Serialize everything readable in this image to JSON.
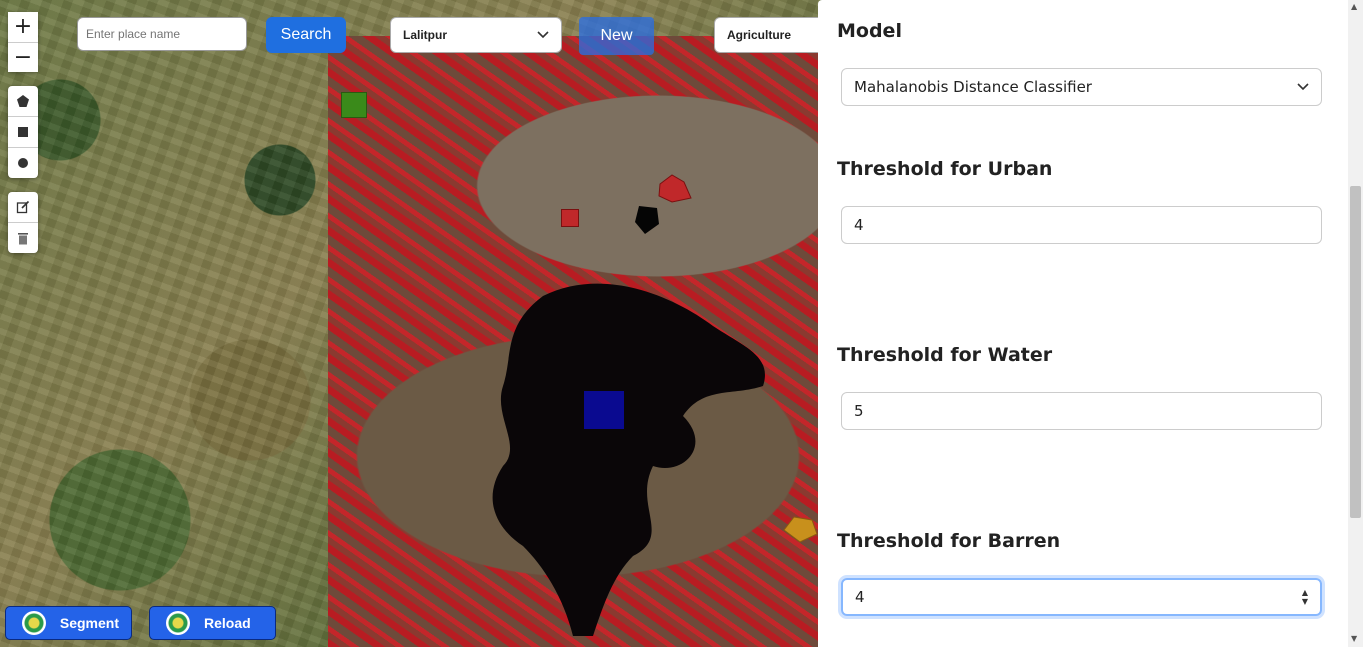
{
  "map": {
    "zoom_in": "+",
    "zoom_out": "−",
    "draw_tools": [
      "polygon-icon",
      "rectangle-icon",
      "circle-icon"
    ],
    "edit_tools": [
      "edit-icon",
      "trash-icon"
    ]
  },
  "toolbar": {
    "place_placeholder": "Enter place name",
    "search_label": "Search",
    "district_select": "Lalitpur",
    "new_label": "New",
    "class_select": "Agriculture"
  },
  "actions": {
    "segment_label": "Segment",
    "reload_label": "Reload"
  },
  "panel": {
    "model_heading": "Model",
    "model_value": "Mahalanobis Distance Classifier",
    "urban_heading": "Threshold for Urban",
    "urban_value": "4",
    "water_heading": "Threshold for Water",
    "water_value": "5",
    "barren_heading": "Threshold for Barren",
    "barren_value": "4"
  },
  "colors": {
    "accent": "#1f6fe0",
    "agriculture_marker": "#3a8a1a",
    "water_marker": "#0a0a90",
    "urban_marker": "#c0282a",
    "barren_marker": "#c8901c"
  }
}
